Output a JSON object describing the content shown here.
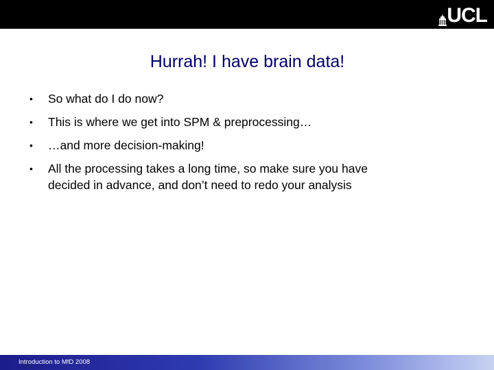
{
  "header": {
    "logo_text": "UCL",
    "colors": {
      "bar": "#000000",
      "logo": "#ffffff"
    }
  },
  "slide": {
    "title": "Hurrah! I have brain data!",
    "title_color": "#000066",
    "bullet_symbol": "•",
    "bullets": [
      "So what do I do now?",
      "This is where we get into SPM & preprocessing…",
      "…and more decision-making!",
      "All the processing takes a long time, so make sure you have decided in advance, and don’t need to redo your analysis"
    ]
  },
  "footer": {
    "text": "Introduction to MfD 2008",
    "colors": {
      "start": "#1c1c8c",
      "end": "#c8d2f2"
    }
  }
}
